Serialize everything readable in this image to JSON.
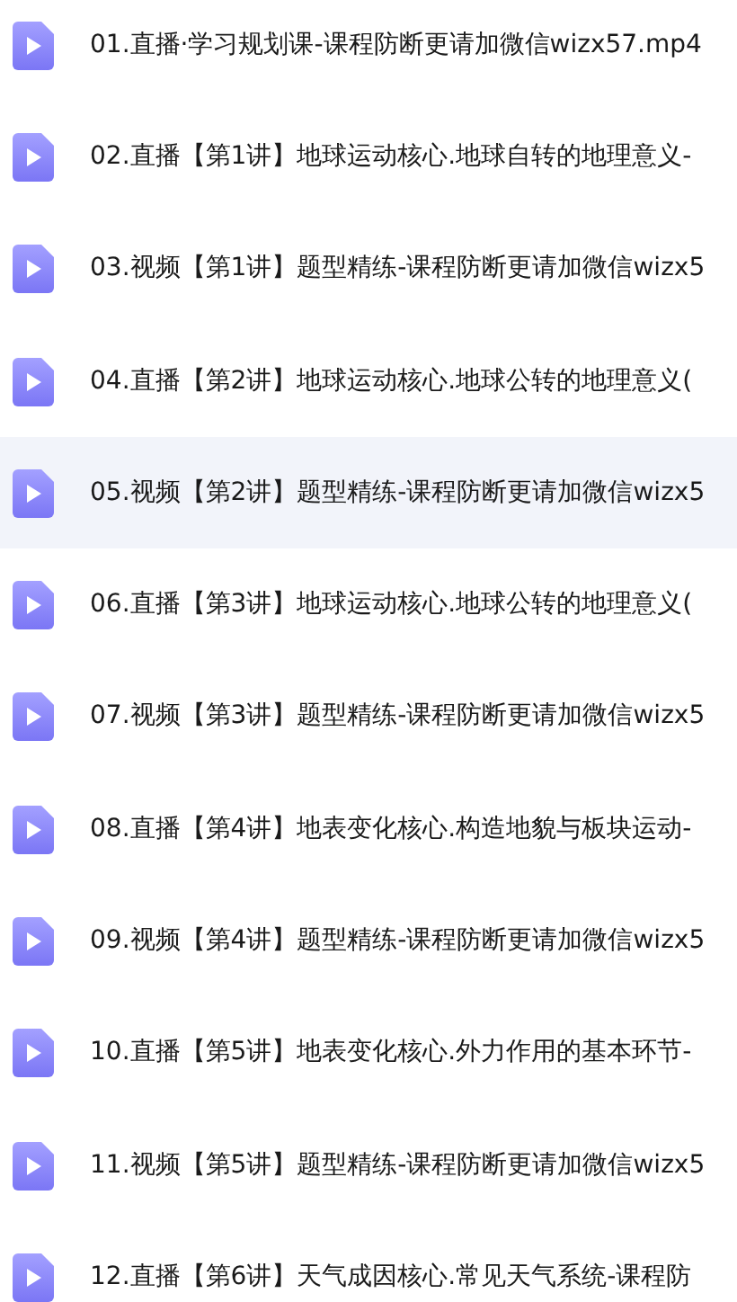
{
  "files": [
    {
      "name": "01.直播·学习规划课-课程防断更请加微信wizx57.mp4",
      "selected": false
    },
    {
      "name": "02.直播【第1讲】地球运动核心.地球自转的地理意义-",
      "selected": false
    },
    {
      "name": "03.视频【第1讲】题型精练-课程防断更请加微信wizx5",
      "selected": false
    },
    {
      "name": "04.直播【第2讲】地球运动核心.地球公转的地理意义(",
      "selected": false
    },
    {
      "name": "05.视频【第2讲】题型精练-课程防断更请加微信wizx5",
      "selected": true
    },
    {
      "name": "06.直播【第3讲】地球运动核心.地球公转的地理意义(",
      "selected": false
    },
    {
      "name": "07.视频【第3讲】题型精练-课程防断更请加微信wizx5",
      "selected": false
    },
    {
      "name": "08.直播【第4讲】地表变化核心.构造地貌与板块运动-",
      "selected": false
    },
    {
      "name": "09.视频【第4讲】题型精练-课程防断更请加微信wizx5",
      "selected": false
    },
    {
      "name": "10.直播【第5讲】地表变化核心.外力作用的基本环节-",
      "selected": false
    },
    {
      "name": "11.视频【第5讲】题型精练-课程防断更请加微信wizx5",
      "selected": false
    },
    {
      "name": "12.直播【第6讲】天气成因核心.常见天气系统-课程防",
      "selected": false
    }
  ]
}
